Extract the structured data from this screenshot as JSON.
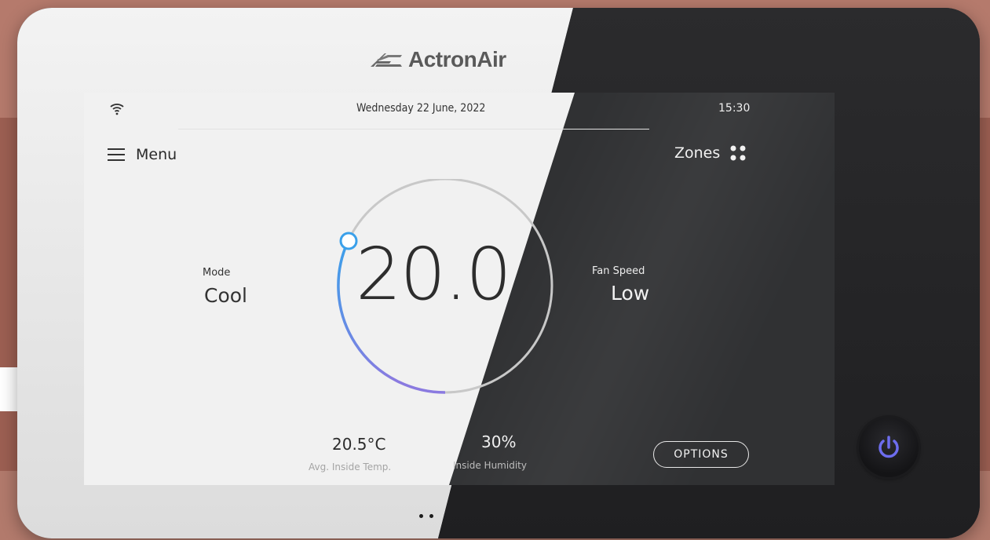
{
  "brand": {
    "name": "ActronAir"
  },
  "status_bar": {
    "date": "Wednesday 22 June, 2022",
    "time": "15:30",
    "wifi_icon": "wifi-icon"
  },
  "nav": {
    "menu_label": "Menu",
    "zones_label": "Zones"
  },
  "mode": {
    "label": "Mode",
    "value": "Cool"
  },
  "fan_speed": {
    "label": "Fan Speed",
    "value": "Low"
  },
  "setpoint": {
    "value": "20.0"
  },
  "inside_temp": {
    "value": "20.5°C",
    "label": "Avg. Inside Temp."
  },
  "humidity": {
    "value": "30%",
    "label": "Inside Humidity"
  },
  "options": {
    "label": "OPTIONS"
  },
  "colors": {
    "dial_gradient_start": "#3aa0ea",
    "dial_gradient_end": "#8a7ae0",
    "power_icon": "#6d6dee"
  }
}
